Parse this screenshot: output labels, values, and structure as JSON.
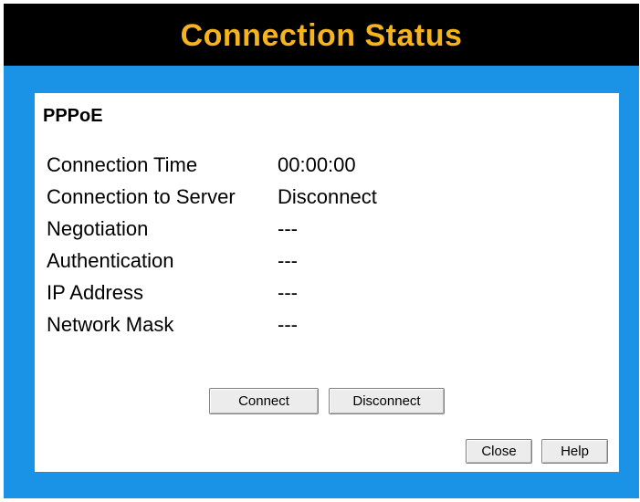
{
  "header": {
    "title": "Connection Status"
  },
  "panel": {
    "section_title": "PPPoE",
    "rows": [
      {
        "label": "Connection Time",
        "value": "00:00:00"
      },
      {
        "label": "Connection to Server",
        "value": "Disconnect"
      },
      {
        "label": "Negotiation",
        "value": "---"
      },
      {
        "label": "Authentication",
        "value": "---"
      },
      {
        "label": "IP Address",
        "value": "---"
      },
      {
        "label": "Network Mask",
        "value": "---"
      }
    ]
  },
  "buttons": {
    "connect_label": "Connect",
    "disconnect_label": "Disconnect",
    "close_label": "Close",
    "help_label": "Help"
  },
  "colors": {
    "title_background": "#000000",
    "title_text": "#f5b41e",
    "frame_background": "#1a93e6",
    "panel_background": "#ffffff"
  }
}
